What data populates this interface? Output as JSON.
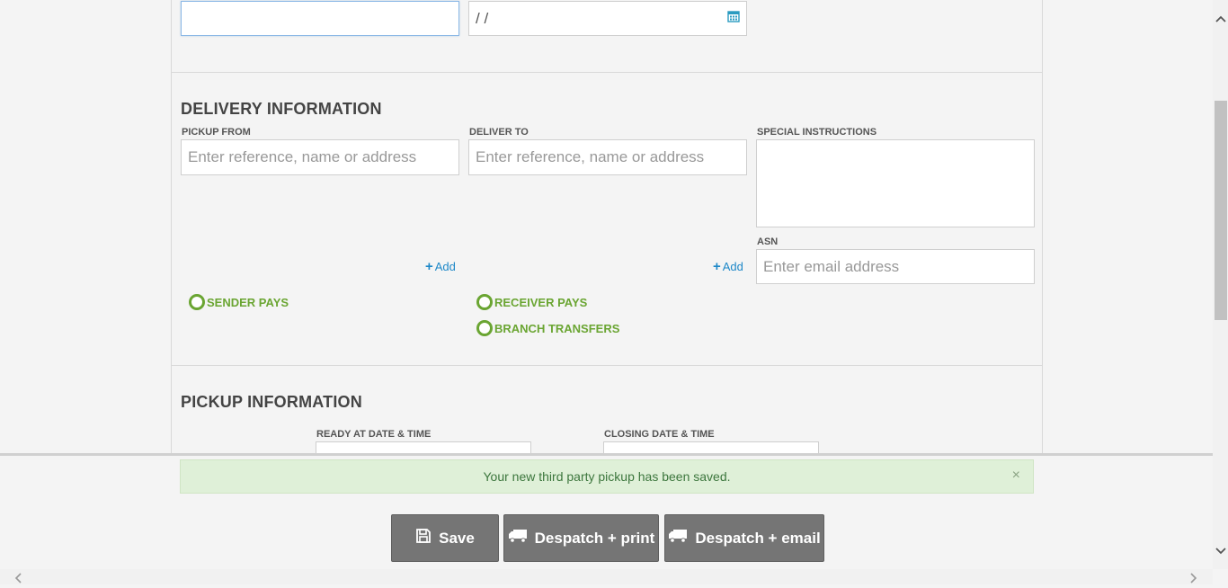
{
  "top_row": {
    "date_value": " / /"
  },
  "delivery": {
    "title": "DELIVERY INFORMATION",
    "pickup_from_label": "PICKUP FROM",
    "pickup_from_placeholder": "Enter reference, name or address",
    "deliver_to_label": "DELIVER TO",
    "deliver_to_placeholder": "Enter reference, name or address",
    "special_instructions_label": "SPECIAL INSTRUCTIONS",
    "asn_label": "ASN",
    "asn_placeholder": "Enter email address",
    "add_label": "Add",
    "payment_options": [
      "SENDER PAYS",
      "RECEIVER PAYS",
      "BRANCH TRANSFERS"
    ]
  },
  "pickup": {
    "title": "PICKUP INFORMATION",
    "ready_label": "READY AT DATE & TIME",
    "closing_label": "CLOSING DATE & TIME"
  },
  "alert": {
    "message": "Your new third party pickup has been saved.",
    "close": "×"
  },
  "actions": {
    "save": "Save",
    "despatch_print": "Despatch + print",
    "despatch_email": "Despatch + email"
  },
  "colors": {
    "accent_green": "#6aa532",
    "link_blue": "#1e88c8",
    "button_gray": "#757575",
    "alert_bg": "#dff0d8"
  }
}
